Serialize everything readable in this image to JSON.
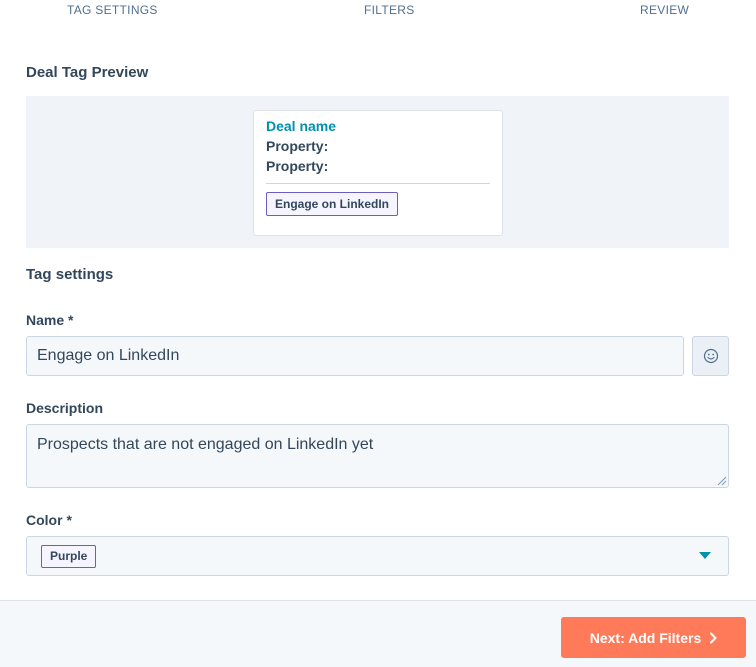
{
  "steps": {
    "tag_settings": "TAG SETTINGS",
    "filters": "FILTERS",
    "review": "REVIEW"
  },
  "preview": {
    "title": "Deal Tag Preview",
    "card": {
      "deal_name": "Deal name",
      "property_1": "Property:",
      "property_2": "Property:",
      "tag_label": "Engage on LinkedIn",
      "tag_color": "#6a5fc1"
    }
  },
  "settings": {
    "title": "Tag settings",
    "name_label": "Name *",
    "name_value": "Engage on LinkedIn",
    "description_label": "Description",
    "description_value": "Prospects that are not engaged on LinkedIn yet",
    "color_label": "Color *",
    "color_value": "Purple"
  },
  "icons": {
    "emoji": "smiley-icon",
    "dropdown": "caret-down-icon",
    "next": "chevron-right-icon"
  },
  "footer": {
    "next_label": "Next: Add Filters"
  },
  "colors": {
    "accent": "#0091ae",
    "primary_button": "#ff7a59",
    "tag_border": "#6a5fc1",
    "text": "#33475b"
  }
}
